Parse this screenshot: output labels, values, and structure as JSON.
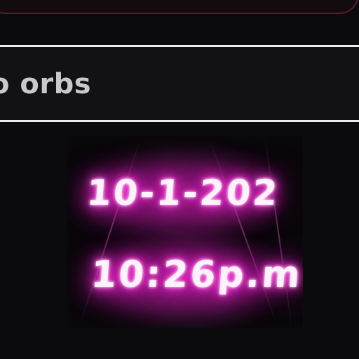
{
  "header": {
    "title": "o orbs"
  },
  "media": {
    "date_text": "10-1-202",
    "time_text": "10:26p.m",
    "glow_color": "#ff2fd8"
  }
}
